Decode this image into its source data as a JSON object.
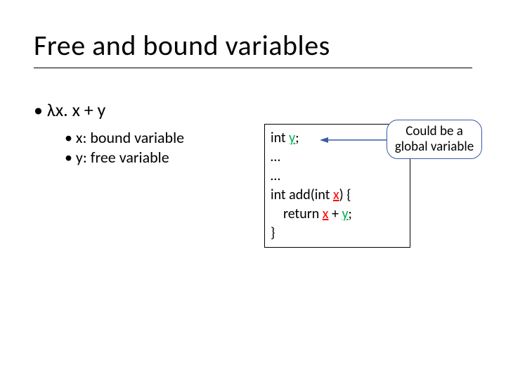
{
  "title": "Free and bound variables",
  "bullets": {
    "l1": "• λx. x + y",
    "l2a": "• x: bound variable",
    "l2b": "• y: free variable"
  },
  "code": {
    "l1a": "int ",
    "l1b": "y",
    "l1c": ";",
    "l2": "…",
    "l3": "…",
    "l4a": "int add(int ",
    "l4b": "x",
    "l4c": ") {",
    "l5a": "return ",
    "l5b": "x",
    "l5c": " + ",
    "l5d": "y",
    "l5e": ";",
    "l6": "}"
  },
  "callout": {
    "line1": "Could be a",
    "line2": "global variable"
  }
}
